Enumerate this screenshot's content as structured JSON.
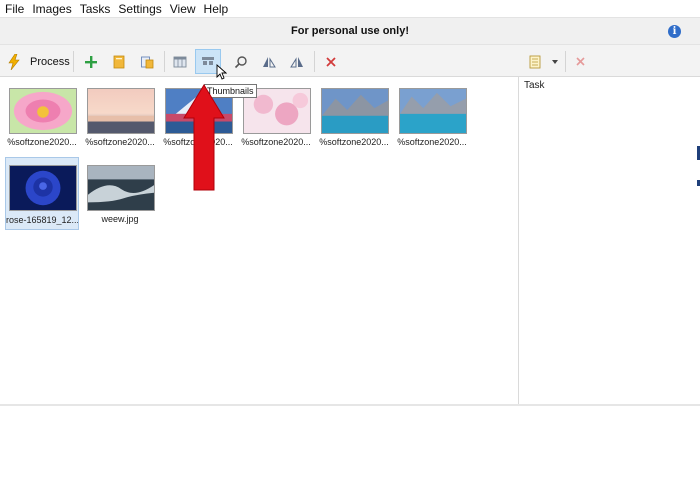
{
  "menubar": {
    "items": [
      "File",
      "Images",
      "Tasks",
      "Settings",
      "View",
      "Help"
    ]
  },
  "banner": {
    "text": "For personal use only!",
    "info_icon": "info-icon"
  },
  "toolbar": {
    "process_label": "Process",
    "tooltip": "Thumbnails",
    "icons": [
      "lightning-icon",
      "add-icon",
      "folder-icon",
      "paste-folder-icon",
      "list-view-icon",
      "thumbnails-view-icon",
      "search-icon",
      "flip-left-icon",
      "flip-right-icon",
      "delete-icon",
      "task-list-icon",
      "dropdown-icon",
      "close-task-icon"
    ],
    "accent_color": "#cce4f7"
  },
  "thumbnails": [
    {
      "caption": "%softzone2020..."
    },
    {
      "caption": "%softzone2020..."
    },
    {
      "caption": "%softzone2020..."
    },
    {
      "caption": "%softzone2020..."
    },
    {
      "caption": "%softzone2020..."
    },
    {
      "caption": "%softzone2020..."
    },
    {
      "caption": "rose-165819_12...",
      "selected": true
    },
    {
      "caption": "weew.jpg"
    }
  ],
  "taskpane": {
    "title": "Task"
  },
  "annotation": {
    "arrow_color": "#e0101a"
  }
}
